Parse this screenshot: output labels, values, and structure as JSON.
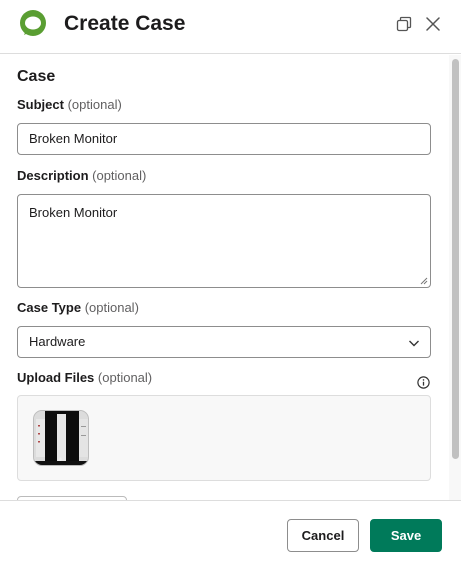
{
  "header": {
    "title": "Create Case",
    "logo_icon": "chat-bubble-logo-icon",
    "popout_icon": "popout-icon",
    "close_icon": "close-icon"
  },
  "form": {
    "section_title": "Case",
    "subject": {
      "label": "Subject",
      "optional": "(optional)",
      "value": "Broken Monitor"
    },
    "description": {
      "label": "Description",
      "optional": "(optional)",
      "value": "Broken Monitor"
    },
    "case_type": {
      "label": "Case Type",
      "optional": "(optional)",
      "selected": "Hardware"
    },
    "upload": {
      "label": "Upload Files",
      "optional": "(optional)",
      "info_icon": "info-icon"
    }
  },
  "footer": {
    "cancel_label": "Cancel",
    "save_label": "Save"
  },
  "colors": {
    "primary": "#007a5a",
    "logo_green": "#5a9e32"
  }
}
